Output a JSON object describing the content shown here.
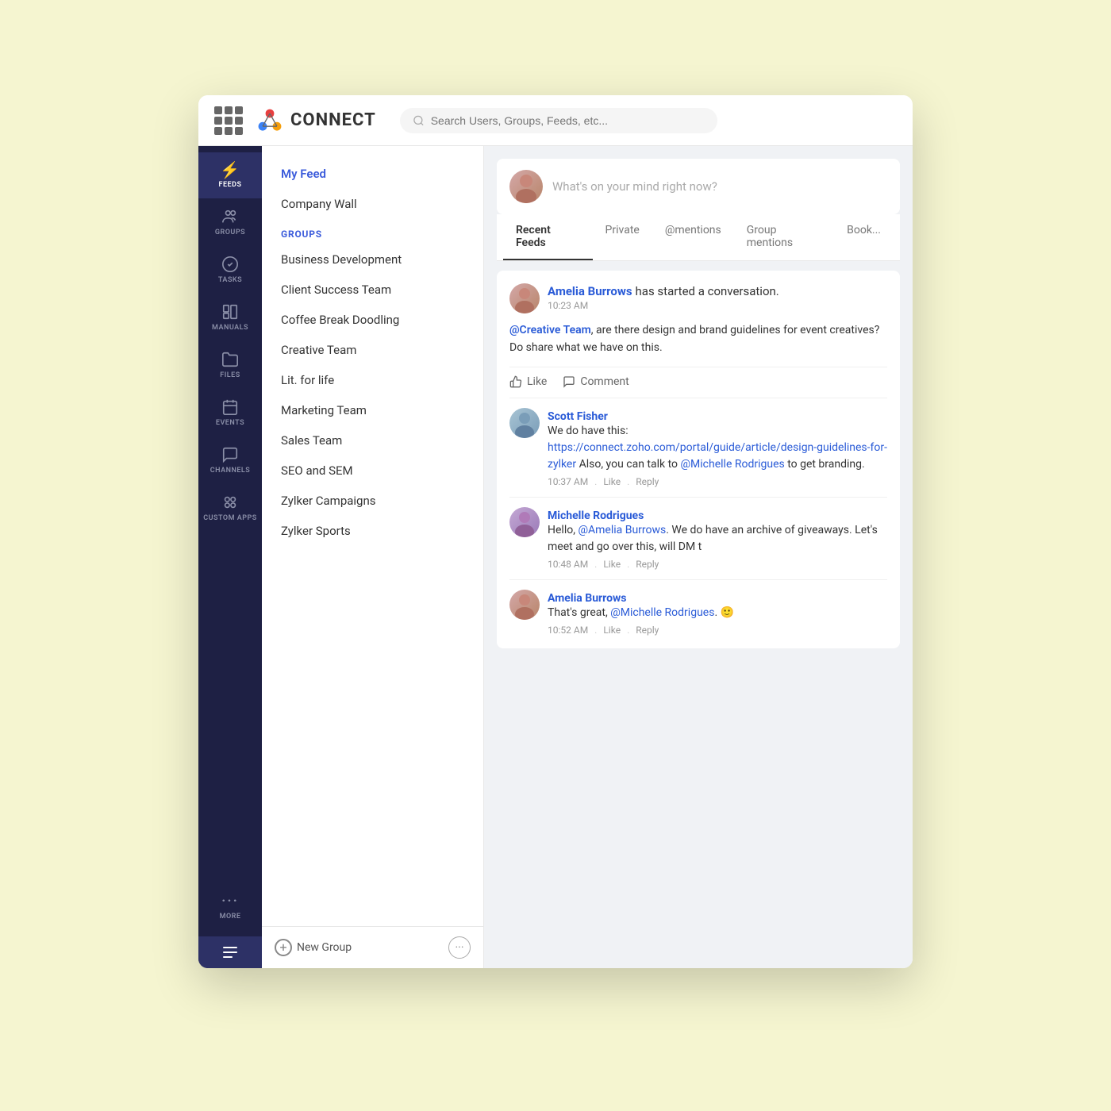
{
  "app": {
    "title": "CONNECT",
    "search_placeholder": "Search Users, Groups, Feeds, etc..."
  },
  "nav": {
    "items": [
      {
        "id": "feeds",
        "label": "FEEDS",
        "icon": "⚡",
        "active": true
      },
      {
        "id": "groups",
        "label": "GROUPS",
        "icon": "👥"
      },
      {
        "id": "tasks",
        "label": "TASKS",
        "icon": "✅"
      },
      {
        "id": "manuals",
        "label": "MANUALS",
        "icon": "📋"
      },
      {
        "id": "files",
        "label": "FILES",
        "icon": "📁"
      },
      {
        "id": "events",
        "label": "EVENTS",
        "icon": "📅"
      },
      {
        "id": "channels",
        "label": "CHANNELS",
        "icon": "💬"
      },
      {
        "id": "custom-apps",
        "label": "CUSTOM APPS",
        "icon": "⚙️"
      },
      {
        "id": "more",
        "label": "MORE",
        "icon": "···"
      }
    ]
  },
  "feeds_sidebar": {
    "my_feed_label": "My Feed",
    "company_wall_label": "Company Wall",
    "groups_header": "GROUPS",
    "groups": [
      {
        "id": "business-dev",
        "label": "Business Development"
      },
      {
        "id": "client-success",
        "label": "Client Success Team"
      },
      {
        "id": "coffee-break",
        "label": "Coffee Break Doodling"
      },
      {
        "id": "creative-team",
        "label": "Creative Team"
      },
      {
        "id": "lit-life",
        "label": "Lit. for life"
      },
      {
        "id": "marketing",
        "label": "Marketing Team"
      },
      {
        "id": "sales",
        "label": "Sales Team"
      },
      {
        "id": "seo-sem",
        "label": "SEO and SEM"
      },
      {
        "id": "zylker-campaigns",
        "label": "Zylker Campaigns"
      },
      {
        "id": "zylker-sports",
        "label": "Zylker Sports"
      }
    ],
    "new_group_label": "New Group"
  },
  "feed": {
    "compose_placeholder": "What's on your mind right now?",
    "tabs": [
      {
        "id": "recent",
        "label": "Recent Feeds",
        "active": true
      },
      {
        "id": "private",
        "label": "Private"
      },
      {
        "id": "mentions",
        "label": "@mentions"
      },
      {
        "id": "group-mentions",
        "label": "Group mentions"
      },
      {
        "id": "bookmarks",
        "label": "Book..."
      }
    ],
    "posts": [
      {
        "id": "post1",
        "author": "Amelia Burrows",
        "action": "has started a conversation.",
        "time": "10:23 AM",
        "body_parts": [
          {
            "type": "mention",
            "text": "@Creative Team"
          },
          {
            "type": "text",
            "text": ", are there design and brand guidelines for event creatives? Do share what we have on this."
          }
        ],
        "like_label": "Like",
        "comment_label": "Comment",
        "comments": [
          {
            "id": "c1",
            "author": "Scott Fisher",
            "body_parts": [
              {
                "type": "text",
                "text": "We do have this: "
              },
              {
                "type": "link",
                "text": "https://connect.zoho.com/portal/guide/article/design-guidelines-for-zylker"
              },
              {
                "type": "text",
                "text": " Also, you can talk to "
              },
              {
                "type": "mention",
                "text": "@Michelle Rodrigues"
              },
              {
                "type": "text",
                "text": " to get branding."
              }
            ],
            "time": "10:37 AM",
            "like_label": "Like",
            "reply_label": "Reply"
          },
          {
            "id": "c2",
            "author": "Michelle Rodrigues",
            "body_parts": [
              {
                "type": "text",
                "text": "Hello, "
              },
              {
                "type": "mention",
                "text": "@Amelia Burrows"
              },
              {
                "type": "text",
                "text": ". We do have an archive of giveaways. Let's meet and go over this, will DM t"
              }
            ],
            "time": "10:48 AM",
            "like_label": "Like",
            "reply_label": "Reply"
          },
          {
            "id": "c3",
            "author": "Amelia Burrows",
            "body_parts": [
              {
                "type": "text",
                "text": "That's great, "
              },
              {
                "type": "mention",
                "text": "@Michelle Rodrigues"
              },
              {
                "type": "text",
                "text": ". 🙂"
              }
            ],
            "time": "10:52 AM",
            "like_label": "Like",
            "reply_label": "Reply"
          }
        ]
      }
    ]
  },
  "colors": {
    "sidebar_bg": "#1e2044",
    "sidebar_active": "#2d3166",
    "accent_blue": "#2a5bd7",
    "groups_header_color": "#3b5bdb"
  }
}
